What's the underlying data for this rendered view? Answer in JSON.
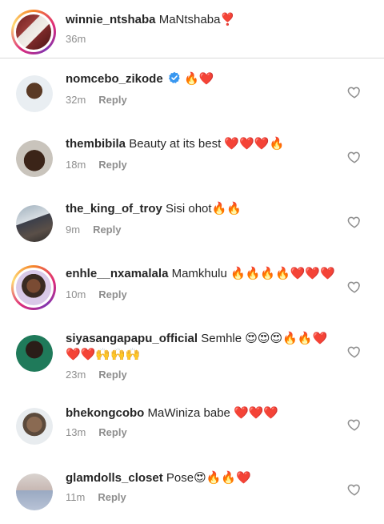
{
  "caption": {
    "username": "winnie_ntshaba",
    "text": "MaNtshaba❣️",
    "time": "36m"
  },
  "reply_label": "Reply",
  "comments": [
    {
      "username": "nomcebo_zikode",
      "verified": true,
      "text": "🔥❤️",
      "time": "32m"
    },
    {
      "username": "thembibila",
      "text": "Beauty at its best ❤️❤️❤️🔥",
      "time": "18m"
    },
    {
      "username": "the_king_of_troy",
      "text": "Sisi ohot🔥🔥",
      "time": "9m"
    },
    {
      "username": "enhle__nxamalala",
      "text": "Mamkhulu 🔥🔥🔥🔥❤️❤️❤️",
      "time": "10m"
    },
    {
      "username": "siyasangapapu_official",
      "text": "Semhle 😍😍😍🔥🔥❤️",
      "text_cont": "❤️❤️🙌🙌🙌",
      "time": "23m"
    },
    {
      "username": "bhekongcobo",
      "text": "MaWiniza babe ❤️❤️❤️",
      "time": "13m"
    },
    {
      "username": "glamdolls_closet",
      "text": "Pose😍🔥🔥❤️",
      "time": "11m"
    }
  ],
  "icons": {
    "like": "heart-outline-icon",
    "verified": "verified-badge-icon"
  },
  "colors": {
    "username": "#262626",
    "meta": "#8e8e8e",
    "verified": "#3897f0",
    "divider": "#dbdbdb"
  }
}
